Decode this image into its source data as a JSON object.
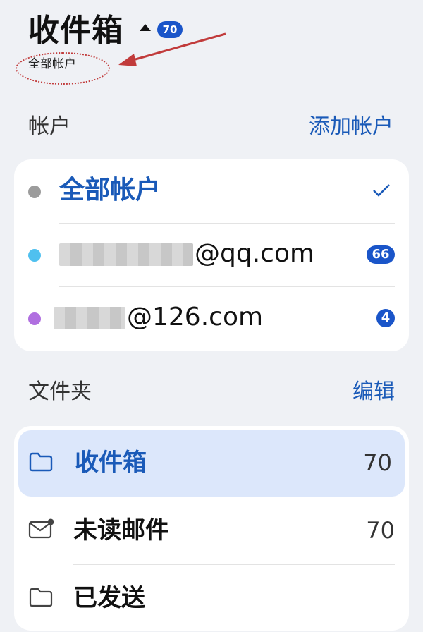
{
  "header": {
    "title": "收件箱",
    "unread_badge": "70",
    "subtitle": "全部帐户"
  },
  "accounts_section": {
    "label": "帐户",
    "add_label": "添加帐户",
    "items": [
      {
        "label": "全部帐户",
        "dot_color": "#9c9c9c",
        "selected": true,
        "count": ""
      },
      {
        "label": "@qq.com",
        "dot_color": "#4fc0ef",
        "selected": false,
        "count": "66"
      },
      {
        "label": "@126.com",
        "dot_color": "#b06fe0",
        "selected": false,
        "count": "4"
      }
    ]
  },
  "folders_section": {
    "label": "文件夹",
    "edit_label": "编辑",
    "items": [
      {
        "label": "收件箱",
        "count": "70",
        "icon": "folder-icon",
        "selected": true
      },
      {
        "label": "未读邮件",
        "count": "70",
        "icon": "unread-mail-icon",
        "selected": false
      },
      {
        "label": "已发送",
        "count": "",
        "icon": "folder-icon",
        "selected": false
      }
    ]
  },
  "colors": {
    "accent": "#1a55c9",
    "background": "#eff1f5",
    "selected_bg": "#dce7fb",
    "annotation": "#c13b3b"
  }
}
